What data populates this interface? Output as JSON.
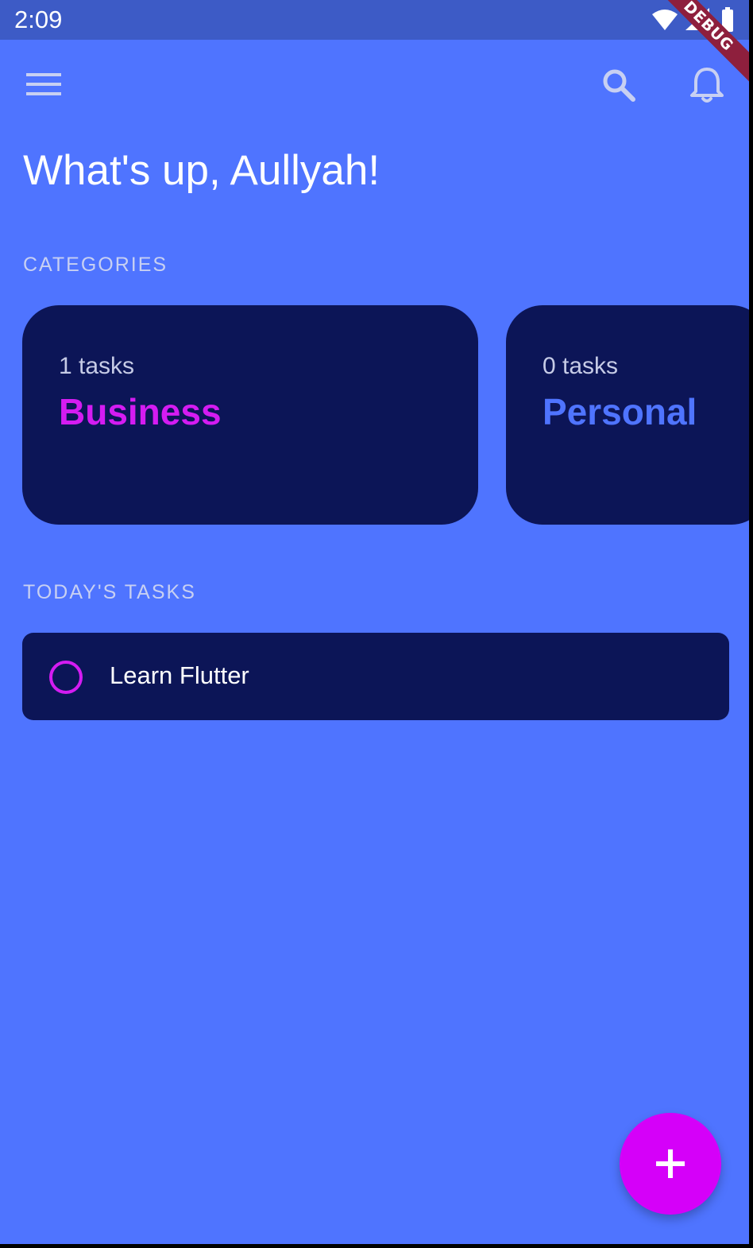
{
  "status_bar": {
    "time": "2:09",
    "debug_label": "DEBUG",
    "icons": [
      "wifi-icon",
      "cell-signal-icon",
      "battery-icon"
    ]
  },
  "app_bar": {
    "icons": [
      "menu-icon",
      "search-icon",
      "notifications-bell-icon"
    ]
  },
  "greeting": "What's up, Aullyah!",
  "categories_section": {
    "label": "CATEGORIES",
    "cards": [
      {
        "count_text": "1 tasks",
        "name": "Business",
        "name_color": "#d41cf2"
      },
      {
        "count_text": "0 tasks",
        "name": "Personal",
        "name_color": "#4f74ff"
      }
    ]
  },
  "tasks_section": {
    "label": "TODAY'S TASKS",
    "tasks": [
      {
        "title": "Learn Flutter",
        "done": false
      }
    ]
  },
  "fab": {
    "icon": "add-icon"
  },
  "colors": {
    "background": "#4f74ff",
    "status_bar": "#3d5bc6",
    "card": "#0c1557",
    "accent": "#d500f9",
    "debug_ribbon": "#8e1f3d"
  }
}
